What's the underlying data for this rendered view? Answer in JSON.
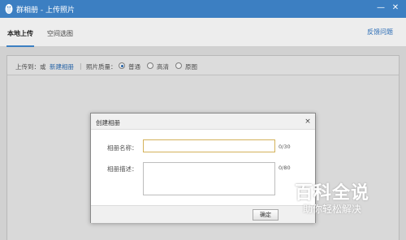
{
  "window": {
    "title": "群相册 - 上传照片",
    "logo_icon": "qq-penguin-icon",
    "minimize_glyph": "—",
    "close_glyph": "✕"
  },
  "tabs": [
    {
      "label": "本地上传",
      "active": true
    },
    {
      "label": "空间选图",
      "active": false
    }
  ],
  "feedback_label": "反馈问题",
  "upload_bar": {
    "upload_to_label": "上传到：或",
    "new_album_link": "新建相册",
    "separator": "|",
    "quality_label": "照片质量：",
    "quality_options": [
      {
        "label": "普通",
        "checked": true
      },
      {
        "label": "高清",
        "checked": false
      },
      {
        "label": "原图",
        "checked": false
      }
    ]
  },
  "dialog": {
    "title": "创建相册",
    "close_glyph": "×",
    "name_label": "相册名称：",
    "name_value": "",
    "name_counter": "0/30",
    "desc_label": "相册描述：",
    "desc_value": "",
    "desc_counter": "0/80",
    "ok_label": "确定"
  },
  "watermark": {
    "main": "百科全说",
    "sub": "助你轻松解决"
  },
  "colors": {
    "titlebar": "#3c7fc2",
    "link": "#2a6cb5",
    "input_focus_border": "#d4b25a"
  }
}
